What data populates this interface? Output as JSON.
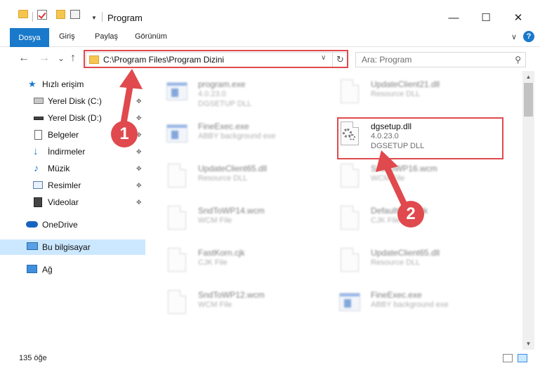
{
  "window": {
    "title": "Program",
    "minimize_glyph": "—",
    "maximize_glyph": "☐",
    "close_glyph": "✕"
  },
  "ribbon": {
    "tabs": [
      "Dosya",
      "Giriş",
      "Paylaş",
      "Görünüm"
    ],
    "help_glyph": "?",
    "expand_glyph": "∨",
    "accent_color": "#1979ca"
  },
  "navigation": {
    "back_glyph": "←",
    "forward_glyph": "→",
    "recent_glyph": "⌄",
    "up_glyph": "↑",
    "address": "C:\\Program Files\\Program Dizini",
    "address_dropdown_glyph": "∨",
    "refresh_glyph": "↻",
    "search_placeholder": "Ara: Program",
    "search_icon": "⚲"
  },
  "sidebar": {
    "items": [
      {
        "label": "Hızlı erişim",
        "icon": "star-icon",
        "pinned": false
      },
      {
        "label": "Yerel Disk (C:)",
        "icon": "drive-icon",
        "pinned": true
      },
      {
        "label": "Yerel Disk (D:)",
        "icon": "drive-icon",
        "pinned": true
      },
      {
        "label": "Belgeler",
        "icon": "documents-icon",
        "pinned": true
      },
      {
        "label": "İndirmeler",
        "icon": "download-icon",
        "pinned": true
      },
      {
        "label": "Müzik",
        "icon": "music-icon",
        "pinned": true
      },
      {
        "label": "Resimler",
        "icon": "pictures-icon",
        "pinned": true
      },
      {
        "label": "Videolar",
        "icon": "videos-icon",
        "pinned": true
      },
      {
        "label": "OneDrive",
        "icon": "cloud-icon",
        "pinned": false
      },
      {
        "label": "Bu bilgisayar",
        "icon": "computer-icon",
        "pinned": false,
        "selected": true
      },
      {
        "label": "Ağ",
        "icon": "network-icon",
        "pinned": false
      }
    ],
    "pin_glyph": "📌"
  },
  "files": [
    {
      "name": "program.exe",
      "line1": "4.0.23.0",
      "line2": "DGSETUP DLL",
      "kind": "exe",
      "blurred": true
    },
    {
      "name": "UpdateClient21.dll",
      "line1": "Resource DLL",
      "line2": "",
      "kind": "dll",
      "blurred": true
    },
    {
      "name": "FineExec.exe",
      "line1": "ABBY background exe",
      "line2": "",
      "kind": "exe",
      "blurred": true
    },
    {
      "name": "dgsetup.dll",
      "line1": "4.0.23.0",
      "line2": "DGSETUP DLL",
      "kind": "dll",
      "blurred": false
    },
    {
      "name": "UpdateClient65.dll",
      "line1": "Resource DLL",
      "line2": "",
      "kind": "dll",
      "blurred": true
    },
    {
      "name": "SndToWP16.wcm",
      "line1": "WCM File",
      "line2": "",
      "kind": "file",
      "blurred": true
    },
    {
      "name": "SndToWP14.wcm",
      "line1": "WCM File",
      "line2": "",
      "kind": "file",
      "blurred": true
    },
    {
      "name": "DefaultCom.cjk",
      "line1": "CJK File",
      "line2": "",
      "kind": "file",
      "blurred": true
    },
    {
      "name": "FastKorn.cjk",
      "line1": "CJK File",
      "line2": "",
      "kind": "file",
      "blurred": true
    },
    {
      "name": "UpdateClient65.dll",
      "line1": "Resource DLL",
      "line2": "",
      "kind": "dll",
      "blurred": true
    },
    {
      "name": "SndToWP12.wcm",
      "line1": "WCM File",
      "line2": "",
      "kind": "file",
      "blurred": true
    },
    {
      "name": "FineExec.exe",
      "line1": "ABBY background exe",
      "line2": "",
      "kind": "exe",
      "blurred": true
    }
  ],
  "scrollbar": {
    "up_glyph": "▲",
    "down_glyph": "▼"
  },
  "status": {
    "count_text": "135 öğe"
  },
  "callouts": [
    {
      "number": "1",
      "color": "#e0494d"
    },
    {
      "number": "2",
      "color": "#e0494d"
    }
  ]
}
